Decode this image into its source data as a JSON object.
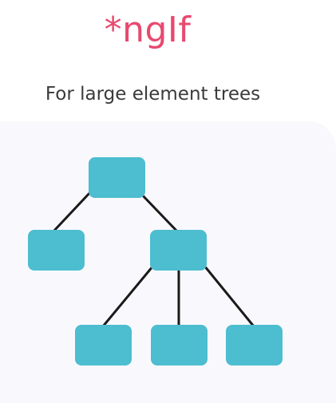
{
  "title": "*ngIf",
  "subtitle": "For large element trees",
  "colors": {
    "title": "#e8486f",
    "subtitle": "#3a3a3a",
    "panel": "#f9f9fd",
    "node": "#4dbdd0",
    "edge": "#1a1a1a"
  }
}
